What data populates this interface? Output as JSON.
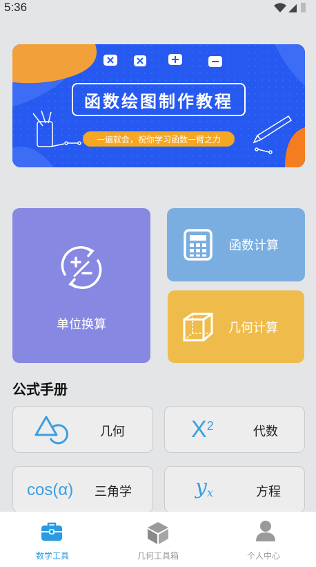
{
  "status": {
    "time": "5:36"
  },
  "banner": {
    "title": "函数绘图制作教程",
    "subtitle": "一遍就会，祝你学习函数一臂之力"
  },
  "cards": {
    "unit": "单位换算",
    "function": "函数计算",
    "geometry": "几何计算"
  },
  "section": {
    "title": "公式手册"
  },
  "formulas": {
    "geometry": {
      "label": "几何"
    },
    "algebra": {
      "label": "代数",
      "symbol": "X",
      "exponent": "2"
    },
    "trig": {
      "label": "三角学",
      "symbol": "cos(α)"
    },
    "equation": {
      "label": "方程",
      "symbol": "y",
      "subscript": "x"
    }
  },
  "tabbar": {
    "items": [
      {
        "label": "数学工具",
        "active": true
      },
      {
        "label": "几何工具箱",
        "active": false
      },
      {
        "label": "个人中心",
        "active": false
      }
    ]
  },
  "colors": {
    "accent": "#2a9be0",
    "banner_blue": "#2659f0",
    "unit_card": "#8788e2",
    "function_card": "#7aaee0",
    "geometry_card": "#efbc4c",
    "icon_blue": "#3aa0e0"
  }
}
